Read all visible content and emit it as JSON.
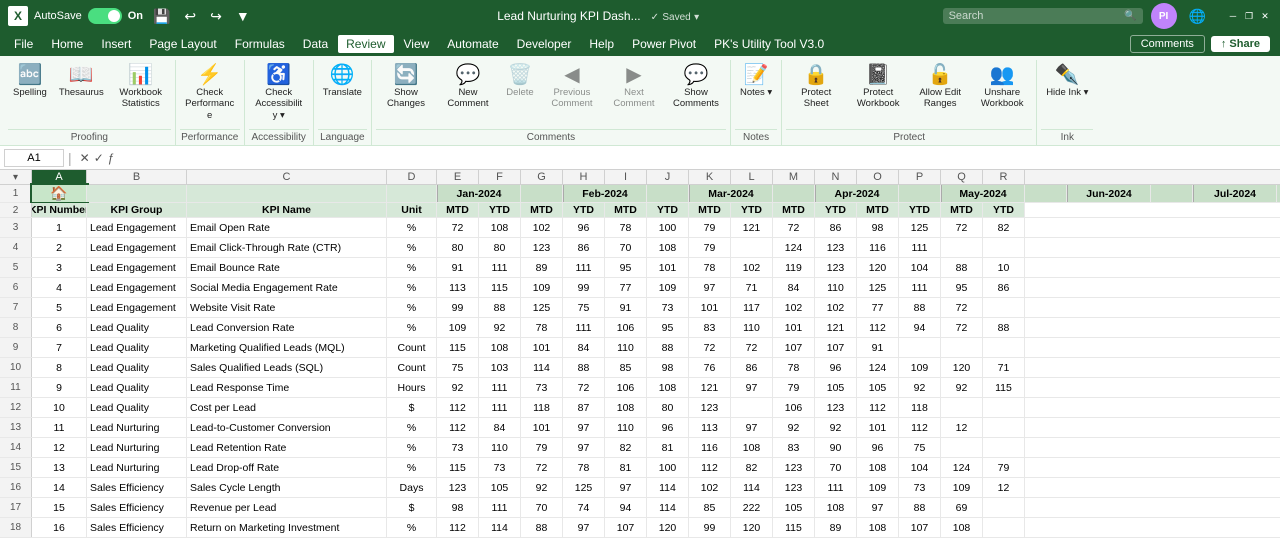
{
  "titlebar": {
    "logo": "X",
    "autosave_label": "AutoSave",
    "autosave_on": "On",
    "filename": "Lead Nurturing KPI Dash...",
    "saved_label": "Saved",
    "search_placeholder": "Search",
    "user_initials": "PI",
    "minimize": "─",
    "restore": "❐",
    "close": "✕"
  },
  "menubar": {
    "items": [
      "File",
      "Home",
      "Insert",
      "Page Layout",
      "Formulas",
      "Data",
      "Review",
      "View",
      "Automate",
      "Developer",
      "Help",
      "Power Pivot",
      "PK's Utility Tool V3.0"
    ],
    "active": "Review"
  },
  "ribbon": {
    "groups": [
      {
        "label": "Proofing",
        "items": [
          {
            "id": "spelling",
            "icon": "🔤",
            "label": "Spelling",
            "type": "big"
          },
          {
            "id": "thesaurus",
            "icon": "📖",
            "label": "Thesaurus",
            "type": "big"
          },
          {
            "id": "workbook-stats",
            "icon": "📊",
            "label": "Workbook\nStatistics",
            "type": "big"
          }
        ]
      },
      {
        "label": "Performance",
        "items": [
          {
            "id": "check-performance",
            "icon": "⚡",
            "label": "Check\nPerformance",
            "type": "big"
          }
        ]
      },
      {
        "label": "Accessibility",
        "items": [
          {
            "id": "check-accessibility",
            "icon": "♿",
            "label": "Check\nAccessibility",
            "type": "big",
            "dropdown": true
          }
        ]
      },
      {
        "label": "Language",
        "items": [
          {
            "id": "translate",
            "icon": "🌐",
            "label": "Translate",
            "type": "big"
          }
        ]
      },
      {
        "label": "Comments",
        "items": [
          {
            "id": "show-changes",
            "icon": "🔄",
            "label": "Show\nChanges",
            "type": "big"
          },
          {
            "id": "new-comment",
            "icon": "💬",
            "label": "New\nComment",
            "type": "big"
          },
          {
            "id": "delete-comment",
            "icon": "🗑️",
            "label": "Delete",
            "type": "big",
            "disabled": true
          },
          {
            "id": "previous-comment",
            "icon": "◀",
            "label": "Previous\nComment",
            "type": "big",
            "disabled": true
          },
          {
            "id": "next-comment",
            "icon": "▶",
            "label": "Next\nComment",
            "type": "big",
            "disabled": true
          },
          {
            "id": "show-comments",
            "icon": "💬",
            "label": "Show\nComments",
            "type": "big"
          }
        ]
      },
      {
        "label": "Notes",
        "items": [
          {
            "id": "notes",
            "icon": "📝",
            "label": "Notes",
            "type": "big",
            "dropdown": true
          }
        ]
      },
      {
        "label": "Protect",
        "items": [
          {
            "id": "protect-sheet",
            "icon": "🔒",
            "label": "Protect\nSheet",
            "type": "big"
          },
          {
            "id": "protect-workbook",
            "icon": "📓",
            "label": "Protect\nWorkbook",
            "type": "big"
          },
          {
            "id": "allow-edit-ranges",
            "icon": "🔓",
            "label": "Allow Edit\nRanges",
            "type": "big"
          },
          {
            "id": "unshare-workbook",
            "icon": "👥",
            "label": "Unshare\nWorkbook",
            "type": "big"
          }
        ]
      },
      {
        "label": "Ink",
        "items": [
          {
            "id": "hide-ink",
            "icon": "✒️",
            "label": "Hide\nInk",
            "type": "big",
            "dropdown": true
          }
        ]
      }
    ]
  },
  "formula_bar": {
    "cell_ref": "A1",
    "formula": ""
  },
  "sheet": {
    "col_headers": [
      "A",
      "B",
      "C",
      "D",
      "E",
      "F",
      "G",
      "H",
      "I",
      "J",
      "K",
      "L",
      "M",
      "N",
      "O",
      "P",
      "Q",
      "R"
    ],
    "row1": [
      "",
      "",
      "",
      "",
      "Jan-2024",
      "",
      "Feb-2024",
      "",
      "Mar-2024",
      "",
      "Apr-2024",
      "",
      "May-2024",
      "",
      "Jun-2024",
      "",
      "Jul-2024",
      ""
    ],
    "row2": [
      "KPI Number",
      "KPI Group",
      "KPI Name",
      "Unit",
      "MTD",
      "YTD",
      "MTD",
      "YTD",
      "MTD",
      "YTD",
      "MTD",
      "YTD",
      "MTD",
      "YTD",
      "MTD",
      "YTD",
      "MTD",
      "YTD"
    ],
    "rows": [
      [
        "1",
        "Lead Engagement",
        "Email Open Rate",
        "%",
        "72",
        "108",
        "102",
        "96",
        "78",
        "100",
        "79",
        "121",
        "72",
        "86",
        "98",
        "125",
        "72",
        "82"
      ],
      [
        "2",
        "Lead Engagement",
        "Email Click-Through Rate (CTR)",
        "%",
        "80",
        "80",
        "123",
        "86",
        "70",
        "108",
        "79",
        "",
        "124",
        "123",
        "116",
        "111",
        "",
        ""
      ],
      [
        "3",
        "Lead Engagement",
        "Email Bounce Rate",
        "%",
        "91",
        "111",
        "89",
        "111",
        "95",
        "101",
        "78",
        "102",
        "119",
        "123",
        "120",
        "104",
        "88",
        "10"
      ],
      [
        "4",
        "Lead Engagement",
        "Social Media Engagement Rate",
        "%",
        "113",
        "115",
        "109",
        "99",
        "77",
        "109",
        "97",
        "71",
        "84",
        "110",
        "125",
        "111",
        "95",
        "86"
      ],
      [
        "5",
        "Lead Engagement",
        "Website Visit Rate",
        "%",
        "99",
        "88",
        "125",
        "75",
        "91",
        "73",
        "101",
        "117",
        "102",
        "102",
        "77",
        "88",
        "72",
        ""
      ],
      [
        "6",
        "Lead Quality",
        "Lead Conversion Rate",
        "%",
        "109",
        "92",
        "78",
        "111",
        "106",
        "95",
        "83",
        "110",
        "101",
        "121",
        "112",
        "94",
        "72",
        "88"
      ],
      [
        "7",
        "Lead Quality",
        "Marketing Qualified Leads (MQL)",
        "Count",
        "115",
        "108",
        "101",
        "84",
        "110",
        "88",
        "72",
        "72",
        "107",
        "107",
        "91",
        "",
        "",
        ""
      ],
      [
        "8",
        "Lead Quality",
        "Sales Qualified Leads (SQL)",
        "Count",
        "75",
        "103",
        "114",
        "88",
        "85",
        "98",
        "76",
        "86",
        "78",
        "96",
        "124",
        "109",
        "120",
        "71"
      ],
      [
        "9",
        "Lead Quality",
        "Lead Response Time",
        "Hours",
        "92",
        "111",
        "73",
        "72",
        "106",
        "108",
        "121",
        "97",
        "79",
        "105",
        "105",
        "92",
        "92",
        "115"
      ],
      [
        "10",
        "Lead Quality",
        "Cost per Lead",
        "$",
        "112",
        "111",
        "118",
        "87",
        "108",
        "80",
        "123",
        "",
        "106",
        "123",
        "112",
        "118",
        "",
        ""
      ],
      [
        "11",
        "Lead Nurturing",
        "Lead-to-Customer Conversion",
        "%",
        "112",
        "84",
        "101",
        "97",
        "110",
        "96",
        "113",
        "97",
        "92",
        "92",
        "101",
        "112",
        "12",
        ""
      ],
      [
        "12",
        "Lead Nurturing",
        "Lead Retention Rate",
        "%",
        "73",
        "110",
        "79",
        "97",
        "82",
        "81",
        "116",
        "108",
        "83",
        "90",
        "96",
        "75",
        "",
        ""
      ],
      [
        "13",
        "Lead Nurturing",
        "Lead Drop-off Rate",
        "%",
        "115",
        "73",
        "72",
        "78",
        "81",
        "100",
        "112",
        "82",
        "123",
        "70",
        "108",
        "104",
        "124",
        "79"
      ],
      [
        "14",
        "Sales Efficiency",
        "Sales Cycle Length",
        "Days",
        "123",
        "105",
        "92",
        "125",
        "97",
        "114",
        "102",
        "114",
        "123",
        "111",
        "109",
        "73",
        "109",
        "12"
      ],
      [
        "15",
        "Sales Efficiency",
        "Revenue per Lead",
        "$",
        "98",
        "111",
        "70",
        "74",
        "94",
        "114",
        "85",
        "222",
        "105",
        "108",
        "97",
        "88",
        "69",
        ""
      ],
      [
        "16",
        "Sales Efficiency",
        "Return on Marketing Investment",
        "%",
        "112",
        "114",
        "88",
        "97",
        "107",
        "120",
        "99",
        "120",
        "115",
        "89",
        "108",
        "107",
        "108",
        ""
      ]
    ]
  },
  "comments_button": "Comments",
  "share_button": "Share"
}
